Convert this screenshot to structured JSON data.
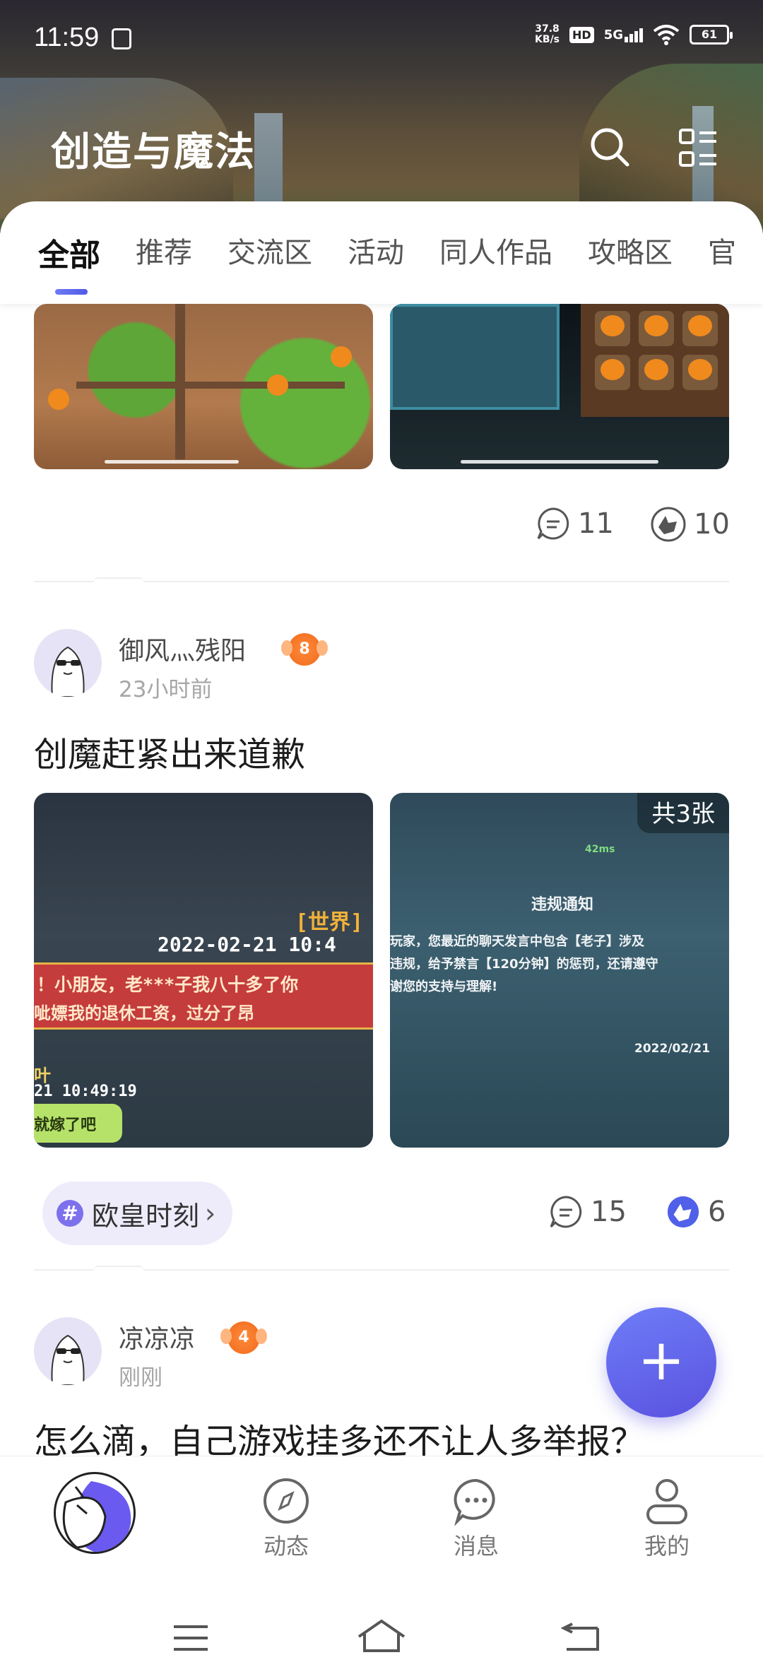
{
  "status_bar": {
    "time": "11:59",
    "net_speed_value": "37.8",
    "net_speed_unit": "KB/s",
    "hd": "HD",
    "network": "5G",
    "battery": "61"
  },
  "header": {
    "title": "创造与魔法",
    "search_icon": "search-icon",
    "menu_icon": "grid-list-icon"
  },
  "tabs": [
    {
      "label": "全部",
      "active": true
    },
    {
      "label": "推荐"
    },
    {
      "label": "交流区"
    },
    {
      "label": "活动"
    },
    {
      "label": "同人作品"
    },
    {
      "label": "攻略区"
    },
    {
      "label": "官"
    }
  ],
  "posts": [
    {
      "comments": "11",
      "likes": "10"
    },
    {
      "user": "御风灬残阳",
      "level": "8",
      "time": "23小时前",
      "title": "创魔赶紧出来道歉",
      "image1": {
        "world_tag": "[世界]",
        "date": "2022-02-21  10:4",
        "line1": "！小朋友，老***子我八十多了你",
        "line2": "呲嫖我的退休工资，过分了昂",
        "name": "叶",
        "time": "21  10:49:19",
        "bubble": "就嫁了吧"
      },
      "image2": {
        "count_tag": "共3张",
        "ping": "42ms",
        "notice_title": "违规通知",
        "line1": "玩家，您最近的聊天发言中包含【老子】涉及",
        "line2": "违规，给予禁言【120分钟】的惩罚，还请遵守",
        "line3": "谢您的支持与理解!",
        "date": "2022/02/21"
      },
      "topic": "欧皇时刻",
      "comments": "15",
      "likes": "6"
    },
    {
      "user": "凉凉凉",
      "level": "4",
      "time": "刚刚",
      "title": "怎么滴，自己游戏挂多还不让人多举报？"
    }
  ],
  "fab": "+",
  "bottom_nav": [
    {
      "label": "",
      "icon": "home-avatar"
    },
    {
      "label": "动态",
      "icon": "compass-icon"
    },
    {
      "label": "消息",
      "icon": "chat-bubble-icon"
    },
    {
      "label": "我的",
      "icon": "user-icon"
    }
  ],
  "colors": {
    "accent": "#5a52e0",
    "tab_indicator": "#6e7bf7",
    "topic_bg": "#eeecfb",
    "level_badge": "#f06a1c"
  }
}
